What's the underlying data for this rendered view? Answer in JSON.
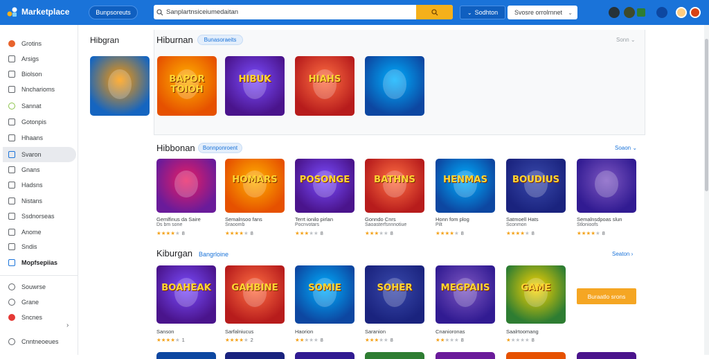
{
  "header": {
    "brand": "Marketplace",
    "pill_button": "Bunpsoreuts",
    "search_placeholder": "Sanplartnsiceiumedaitan",
    "nav_label": "Sodhton",
    "select_value": "Svosre orrolrnnet"
  },
  "sidebar": {
    "items": [
      {
        "label": "Grotins",
        "icon": "compass-icon"
      },
      {
        "label": "Arsigs",
        "icon": "keyboard-icon"
      },
      {
        "label": "Biolson",
        "icon": "monitor-icon"
      },
      {
        "label": "Nncharioms",
        "icon": "window-icon"
      },
      {
        "label": "Sannat",
        "icon": "palette-icon"
      },
      {
        "label": "Gotonpis",
        "icon": "calendar-icon"
      },
      {
        "label": "Hhaans",
        "icon": "book-icon"
      },
      {
        "label": "Svaron",
        "icon": "phone-icon"
      },
      {
        "label": "Gnans",
        "icon": "pen-icon"
      },
      {
        "label": "Hadsns",
        "icon": "chart-icon"
      },
      {
        "label": "Nistans",
        "icon": "image-icon"
      },
      {
        "label": "Ssdnorseas",
        "icon": "grid-icon"
      },
      {
        "label": "Anome",
        "icon": "person-icon"
      },
      {
        "label": "Sndis",
        "icon": "home-icon"
      },
      {
        "label": "Mopfsepiias",
        "icon": "store-icon"
      },
      {
        "label": "Souwrse",
        "icon": "gear-icon"
      },
      {
        "label": "Grane",
        "icon": "help-icon"
      },
      {
        "label": "Sncnes",
        "icon": "star-icon"
      },
      {
        "label": "Cnntneoeues",
        "icon": "user-icon"
      }
    ]
  },
  "sections": {
    "featured": {
      "heading": "Hibgran",
      "title": "Hiburnan",
      "chip": "Bunasoraeits",
      "see_all": "Sonn"
    },
    "row1": {
      "title": "Hibbonan",
      "chip": "Bonnponroent",
      "see_all": "Soaon"
    },
    "row2": {
      "title": "Kiburgan",
      "chip": "Bangrloine",
      "see_all": "Seaton"
    }
  },
  "featured_tiles": [
    {
      "text": "BAPOR TOIOH"
    },
    {
      "text": "HIBUK"
    },
    {
      "text": "HIAHS"
    },
    {
      "text": ""
    }
  ],
  "row1_cards": [
    {
      "title": "Gemlfinus da Saire",
      "sub": "Ds bm sone",
      "stars": 4,
      "count": "8"
    },
    {
      "title": "Semalnsoo fans",
      "sub": "Sraoomb",
      "stars": 4,
      "count": "8"
    },
    {
      "title": "Terrt ionilo pirlan",
      "sub": "Pocnvotars",
      "stars": 3,
      "count": "8"
    },
    {
      "title": "Gonndo Cnrs",
      "sub": "Saoasterfsnnnotiue",
      "stars": 3,
      "count": "8"
    },
    {
      "title": "Honn fom plog",
      "sub": "Pilt",
      "stars": 4,
      "count": "8"
    },
    {
      "title": "Satmoell Hats",
      "sub": "Sconmon",
      "stars": 4,
      "count": "8"
    },
    {
      "title": "Semalnsdpoas slun",
      "sub": "Stlonioofs",
      "stars": 4,
      "count": "8"
    }
  ],
  "row1_tile_text": [
    "",
    "HOMARS",
    "POSONGE",
    "BATHNS",
    "HENMAS",
    "BOUDIUS",
    ""
  ],
  "row2_cards": [
    {
      "title": "Sanson",
      "stars": 4,
      "count": "1"
    },
    {
      "title": "Sarfalniucus",
      "stars": 4,
      "count": "2"
    },
    {
      "title": "Haorion",
      "stars": 2,
      "count": "8"
    },
    {
      "title": "Saranion",
      "stars": 3,
      "count": "8"
    },
    {
      "title": "Cnanioronas",
      "stars": 2,
      "count": "8"
    },
    {
      "title": "Saalrtoomang",
      "stars": 1,
      "count": "8"
    }
  ],
  "row2_tile_text": [
    "BOAHEAK",
    "GAHBINE",
    "SOMIE",
    "SOHER",
    "MEGPAIIS",
    "GAME"
  ],
  "promo_button": "Buraatlo srons",
  "colors": {
    "accent": "#1a73d9",
    "star": "#f4a21a",
    "promo": "#f5a623"
  }
}
